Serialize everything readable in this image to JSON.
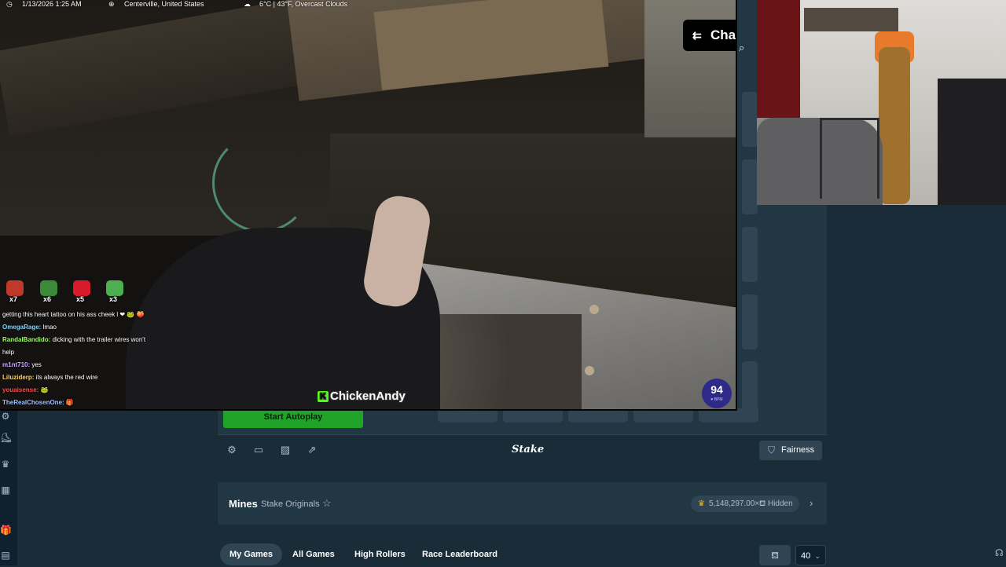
{
  "stream": {
    "datetime": "1/13/2026 1:25 AM",
    "location": "Centerville, United States",
    "weather": "6°C | 43°F, Overcast Clouds",
    "chat_toggle_label": "Chat",
    "watermark": "ChickenAndy",
    "bpm_value": "94",
    "bpm_unit": "♥ BPM",
    "emotes": [
      {
        "count": "x7",
        "color": "#c0392b"
      },
      {
        "count": "x6",
        "color": "#3a8a3a"
      },
      {
        "count": "x5",
        "color": "#d81b2a"
      },
      {
        "count": "x3",
        "color": "#4caf50"
      }
    ],
    "chat": [
      {
        "user": "",
        "user_color": "#ffffff",
        "msg": "getting this heart tattoo on his ass cheek l ❤ 🐸 🍑"
      },
      {
        "user": "OmegaRage:",
        "user_color": "#7fd6ff",
        "msg": "lmao"
      },
      {
        "user": "RandalBandido:",
        "user_color": "#9cff6a",
        "msg": "dicking with the trailer wires won't"
      },
      {
        "user": "",
        "user_color": "#ffffff",
        "msg": "help"
      },
      {
        "user": "m1nt710:",
        "user_color": "#d0a6ff",
        "msg": "yes"
      },
      {
        "user": "Liluziderp:",
        "user_color": "#ffd35c",
        "msg": "its always the red wire"
      },
      {
        "user": "youaisense:",
        "user_color": "#ff4d4d",
        "msg": "🐸"
      },
      {
        "user": "TheRealChosenOne:",
        "user_color": "#9fc0ff",
        "msg": "🎁"
      }
    ]
  },
  "stake": {
    "autoplay_label": "Start Autoplay",
    "logo": "Stake",
    "fairness_label": "Fairness",
    "game_title": "Mines",
    "game_provider": "Stake Originals",
    "max_multiplier": "5,148,297.00×",
    "hidden_label": "Hidden",
    "tabs": [
      "My Games",
      "All Games",
      "High Rollers",
      "Race Leaderboard"
    ],
    "active_tab": "My Games",
    "rows_count": "40",
    "accent": "#1fa329",
    "bg": "#1a2c38"
  }
}
